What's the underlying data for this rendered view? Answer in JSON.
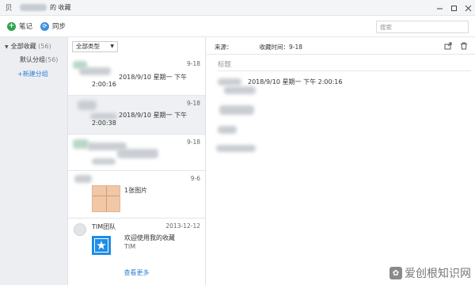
{
  "window": {
    "title": "的 收藏",
    "logo_glyph": "贝",
    "controls": [
      "minimize-icon",
      "maximize-icon",
      "close-icon"
    ]
  },
  "toolbar": {
    "note_label": "笔记",
    "sync_label": "同步",
    "search_placeholder": "搜索"
  },
  "sidebar": {
    "all_label": "全部收藏",
    "all_count": "(56)",
    "default_label": "默认分组",
    "default_count": "(56)",
    "new_group_label": "+新建分组"
  },
  "list": {
    "filter_label": "全部类型",
    "items": [
      {
        "date": "9-18",
        "text_line1": "2018/9/10 星期一 下午",
        "text_line2": "2:00:16"
      },
      {
        "date": "9-18",
        "text_line1": "2018/9/10 星期一 下午",
        "text_line2": "2:00:38"
      },
      {
        "date": "9-18"
      },
      {
        "date": "9-6",
        "caption": "1张图片"
      },
      {
        "date": "2013-12-12",
        "author": "TIM团队",
        "text": "欢迎使用我的收藏",
        "source": "TIM"
      }
    ],
    "more_label": "查看更多"
  },
  "detail": {
    "source_label": "来源：",
    "time_label": "收藏时间：9-18",
    "title_placeholder": "标题",
    "body_text": "2018/9/10 星期一 下午 2:00:16"
  },
  "watermark": {
    "text": "爱创根知识网"
  }
}
